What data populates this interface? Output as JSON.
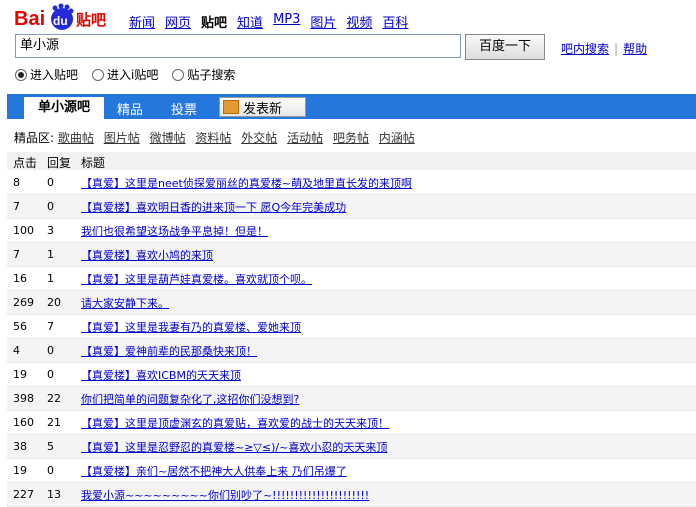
{
  "header": {
    "logo_alt": "Baidu 贴吧",
    "nav": [
      "新闻",
      "网页",
      "贴吧",
      "知道",
      "MP3",
      "图片",
      "视频",
      "百科"
    ],
    "nav_active": 2,
    "search_value": "单小源",
    "search_button": "百度一下",
    "link_inner": "吧内搜索",
    "link_help": "帮助",
    "radios": [
      {
        "label": "进入贴吧",
        "checked": true
      },
      {
        "label": "进入i贴吧",
        "checked": false
      },
      {
        "label": "贴子搜索",
        "checked": false
      }
    ]
  },
  "tabs": {
    "active": "单小源吧",
    "items": [
      "精品",
      "投票"
    ],
    "post_label": "发表新"
  },
  "filters": {
    "prefix": "精品区:",
    "items": [
      "歌曲帖",
      "图片帖",
      "微博帖",
      "资料帖",
      "外交帖",
      "活动帖",
      "吧务帖",
      "内涵帖"
    ]
  },
  "table": {
    "headers": [
      "点击",
      "回复",
      "标题"
    ],
    "rows": [
      {
        "clicks": "8",
        "replies": "0",
        "title": "【真爱】这里是neet侦探爱丽丝的真爱楼~萌及地里直长发的来顶啊"
      },
      {
        "clicks": "7",
        "replies": "0",
        "title": "【真爱楼】喜欢明日香的进来顶一下 愿Q今年完美成功"
      },
      {
        "clicks": "100",
        "replies": "3",
        "title": "我们也很希望这场战争平息掉！但是！"
      },
      {
        "clicks": "7",
        "replies": "1",
        "title": "【真爱楼】喜欢小鸠的来顶"
      },
      {
        "clicks": "16",
        "replies": "1",
        "title": "【真爱】这里是葫芦娃真爱楼。喜欢就顶个呗。"
      },
      {
        "clicks": "269",
        "replies": "20",
        "title": "请大家安静下来。"
      },
      {
        "clicks": "56",
        "replies": "7",
        "title": "【真爱】这里是我妻有乃的真爱楼、爱她来顶"
      },
      {
        "clicks": "4",
        "replies": "0",
        "title": "【真爱】爱神前辈的民那桑快来顶！"
      },
      {
        "clicks": "19",
        "replies": "0",
        "title": "【真爱楼】喜欢ICBM的天天来顶"
      },
      {
        "clicks": "398",
        "replies": "22",
        "title": "你们把简单的问题复杂化了,这招你们没想到?"
      },
      {
        "clicks": "160",
        "replies": "21",
        "title": "【真爱】这里是顶虚渊玄的真爱贴，喜欢爱的战士的天天来顶！"
      },
      {
        "clicks": "38",
        "replies": "5",
        "title": "【真爱】这里是忍野忍的真爱楼~≥▽≤)/~喜欢小忍的天天来顶"
      },
      {
        "clicks": "19",
        "replies": "0",
        "title": "【真爱楼】亲们~居然不把神大人供奉上来 乃们吊爆了"
      },
      {
        "clicks": "227",
        "replies": "13",
        "title": "我爱小源~~~~~~~~~你们别吵了~!!!!!!!!!!!!!!!!!!!!!!"
      }
    ]
  }
}
